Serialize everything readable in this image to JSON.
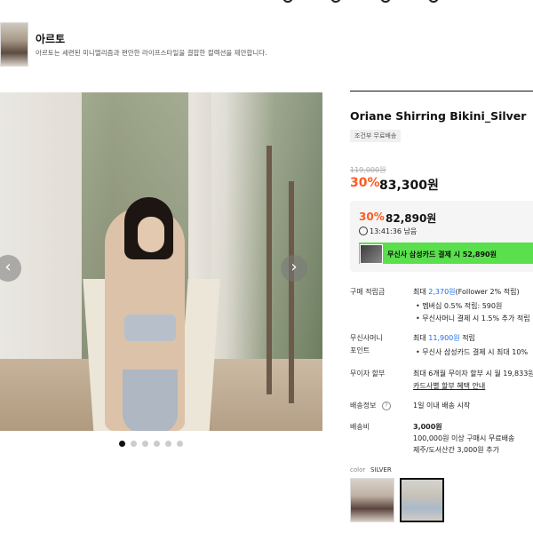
{
  "brand": {
    "name": "아르토",
    "description": "아르토는 세련된 미니멀리즘과 편안한 라이프스타일을 결합한 컬렉션을 제안합니다."
  },
  "gallery": {
    "prev_label": "‹",
    "next_label": "›",
    "slide_count": 6,
    "active_slide": 1
  },
  "product": {
    "title": "Oriane Shirring Bikini_Silver",
    "ship_tag": "조건부 무료배송",
    "original_price": "119,000원",
    "discount_rate": "30%",
    "sale_price": "83,300원"
  },
  "coupon": {
    "rate": "30%",
    "price": "82,890원",
    "timer": "13:41:36 남음",
    "card_text": "무신사 삼성카드 결제 시 52,890원"
  },
  "details": {
    "points": {
      "label": "구매 적립금",
      "max_prefix": "최대",
      "max_amount": "2,370원",
      "max_suffix": "(Follower 2% 적립)",
      "line1": "• 멤버십 0.5% 적립: 590원",
      "line2": "• 무신사머니 결제 시 1.5% 추가 적립"
    },
    "money": {
      "label_line1": "무신사머니",
      "label_line2": "포인트",
      "max_prefix": "최대",
      "max_amount": "11,900원",
      "max_suffix": "적립",
      "line1": "• 무신사 삼성카드 결제 시 최대 10%"
    },
    "installment": {
      "label": "무이자 할부",
      "text": "최대 6개월 무이자 할부 시 월 19,833원",
      "link": "카드사별 할부 혜택 안내"
    },
    "shipping_info": {
      "label": "배송정보",
      "help": "?",
      "text": "1일 이내 배송 시작"
    },
    "shipping_fee": {
      "label": "배송비",
      "amount": "3,000원",
      "line1": "100,000원 이상 구매시 무료배송",
      "line2": "제주/도서산간 3,000원 추가"
    }
  },
  "color": {
    "label": "color",
    "value": "SILVER"
  },
  "colors": {
    "accent": "#ff5a1f",
    "link": "#1a6ef0",
    "card_banner": "#59e04c"
  }
}
